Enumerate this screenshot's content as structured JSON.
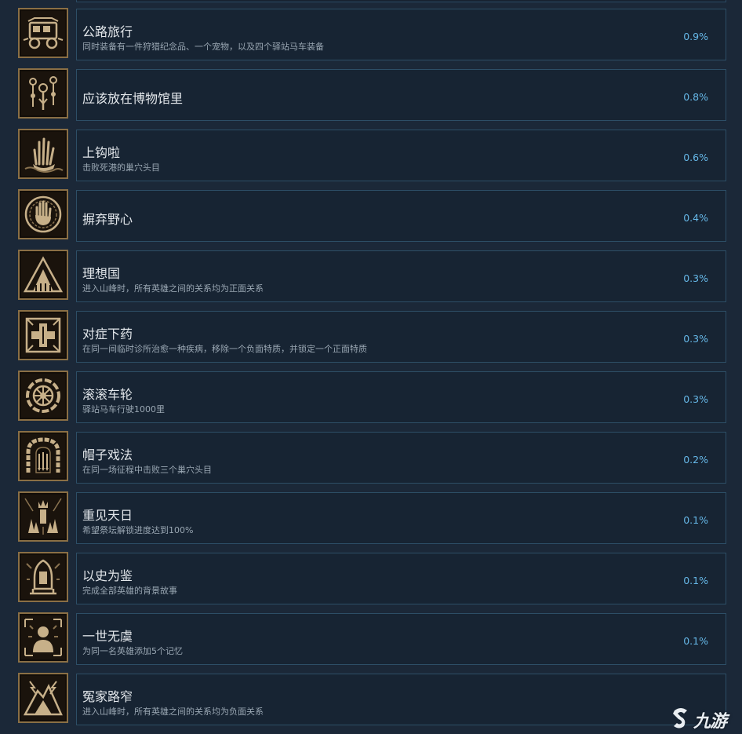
{
  "achievements": [
    {
      "title": "公路旅行",
      "desc": "同时装备有一件狩猎纪念品、一个宠物，以及四个驿站马车装备",
      "percent": "0.9%",
      "icon": "stagecoach-icon"
    },
    {
      "title": "应该放在博物馆里",
      "desc": "",
      "percent": "0.8%",
      "icon": "relic-trinkets-icon"
    },
    {
      "title": "上钩啦",
      "desc": "击败死港的巢穴头目",
      "percent": "0.6%",
      "icon": "grasping-hand-icon"
    },
    {
      "title": "摒弃野心",
      "desc": "",
      "percent": "0.4%",
      "icon": "open-palm-icon"
    },
    {
      "title": "理想国",
      "desc": "进入山峰时，所有英雄之间的关系均为正面关系",
      "percent": "0.3%",
      "icon": "mountain-peak-icon"
    },
    {
      "title": "对症下药",
      "desc": "在同一间临时诊所治愈一种疾病，移除一个负面特质，并锁定一个正面特质",
      "percent": "0.3%",
      "icon": "medical-cross-icon"
    },
    {
      "title": "滚滚车轮",
      "desc": "驿站马车行驶1000里",
      "percent": "0.3%",
      "icon": "wagon-wheel-icon"
    },
    {
      "title": "帽子戏法",
      "desc": "在同一场征程中击败三个巢穴头目",
      "percent": "0.2%",
      "icon": "stone-archway-icon"
    },
    {
      "title": "重见天日",
      "desc": "希望祭坛解锁进度达到100%",
      "percent": "0.1%",
      "icon": "crowned-altar-icon"
    },
    {
      "title": "以史为鉴",
      "desc": "完成全部英雄的背景故事",
      "percent": "0.1%",
      "icon": "hooded-figure-icon"
    },
    {
      "title": "一世无虞",
      "desc": "为同一名英雄添加5个记忆",
      "percent": "0.1%",
      "icon": "hero-portrait-icon"
    },
    {
      "title": "冤家路窄",
      "desc": "进入山峰时，所有英雄之间的关系均为负面关系",
      "percent": "",
      "icon": "storm-peak-icon"
    }
  ],
  "watermark": {
    "text": "九游",
    "logo": "jiuyou-logo-icon"
  }
}
